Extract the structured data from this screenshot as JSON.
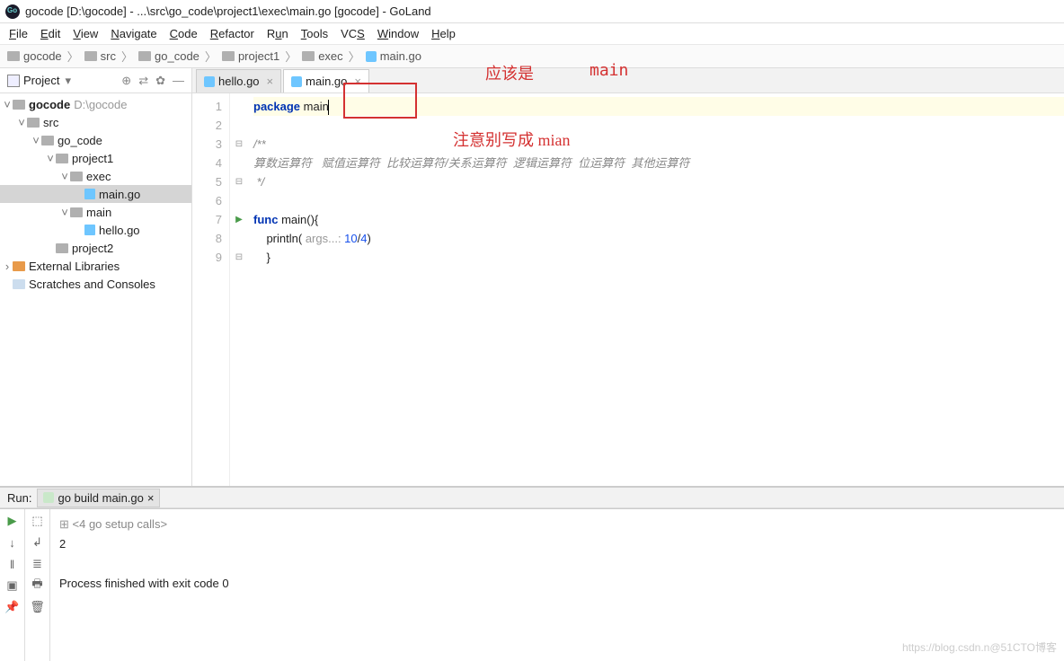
{
  "title": "gocode [D:\\gocode] - ...\\src\\go_code\\project1\\exec\\main.go [gocode] - GoLand",
  "menu": [
    "File",
    "Edit",
    "View",
    "Navigate",
    "Code",
    "Refactor",
    "Run",
    "Tools",
    "VCS",
    "Window",
    "Help"
  ],
  "breadcrumb": [
    "gocode",
    "src",
    "go_code",
    "project1",
    "exec",
    "main.go"
  ],
  "sidebar": {
    "header": "Project",
    "tree": {
      "root": {
        "label": "gocode",
        "path": "D:\\gocode"
      },
      "src": "src",
      "go_code": "go_code",
      "project1": "project1",
      "exec": "exec",
      "main_go": "main.go",
      "main_dir": "main",
      "hello_go": "hello.go",
      "project2": "project2",
      "ext_lib": "External Libraries",
      "scratches": "Scratches and Consoles"
    }
  },
  "tabs": [
    {
      "label": "hello.go",
      "active": false
    },
    {
      "label": "main.go",
      "active": true
    }
  ],
  "code": {
    "l1_kw": "package",
    "l1_id": "main",
    "l3": "/**",
    "l4": "算数运算符   赋值运算符  比较运算符/关系运算符  逻辑运算符  位运算符  其他运算符",
    "l5": " */",
    "l7_kw": "func",
    "l7_id": "main(){",
    "l8_fn": "println(",
    "l8_hint": " args...: ",
    "l8_expr": "10",
    "l8_div": "/",
    "l8_den": "4",
    "l8_close": ")",
    "l9": "}"
  },
  "annotations": {
    "a1": "应该是",
    "a2": "main",
    "a3": "注意别写成 mian"
  },
  "run": {
    "label": "Run:",
    "config": "go build main.go",
    "setup": "<4 go setup calls>",
    "output": "2",
    "finished": "Process finished with exit code 0"
  },
  "watermark": "https://blog.csdn.n@51CTO博客"
}
